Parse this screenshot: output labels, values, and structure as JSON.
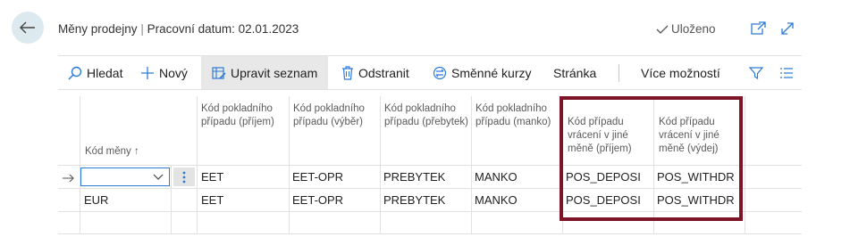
{
  "header": {
    "title": "Měny prodejny",
    "separator": "|",
    "work_date": "Pracovní datum: 02.01.2023",
    "saved_label": "Uloženo"
  },
  "toolbar": {
    "search": "Hledat",
    "new": "Nový",
    "edit_list": "Upravit seznam",
    "delete": "Odstranit",
    "exchange_rates": "Směnné kurzy",
    "page": "Stránka",
    "more_options": "Více možností"
  },
  "table": {
    "columns": [
      "Kód měny",
      "Kód pokladního případu (příjem)",
      "Kód pokladního případu (výběr)",
      "Kód pokladního případu (přebytek)",
      "Kód pokladního případu (manko)",
      "Kód případu vrácení v jiné měně (příjem)",
      "Kód případu vrácení v jiné měně (výdej)"
    ],
    "sort_indicator": "↑",
    "rows": [
      [
        "",
        "EET",
        "EET-OPR",
        "PREBYTEK",
        "MANKO",
        "POS_DEPOSI",
        "POS_WITHDR"
      ],
      [
        "EUR",
        "EET",
        "EET-OPR",
        "PREBYTEK",
        "MANKO",
        "POS_DEPOSI",
        "POS_WITHDR"
      ]
    ]
  },
  "colors": {
    "accent": "#2d7ad6",
    "highlight_border": "#7d1427",
    "back_bg": "#dce9ef"
  }
}
